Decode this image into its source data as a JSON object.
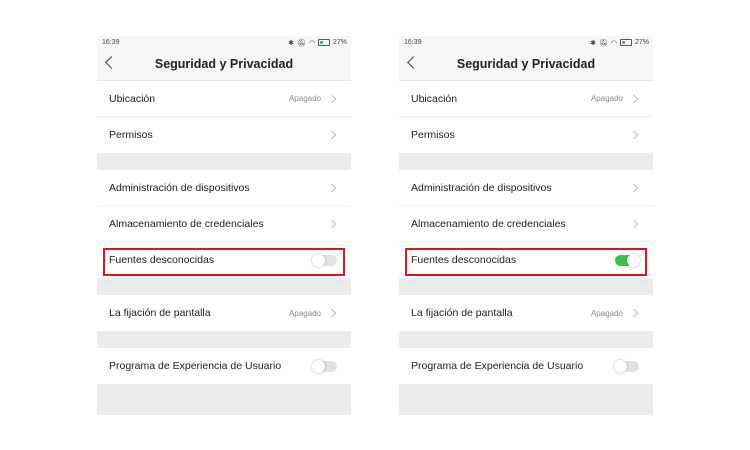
{
  "screens": [
    {
      "status": {
        "time": "16:39",
        "battery": "27%"
      },
      "title": "Seguridad y Privacidad",
      "rows": {
        "ubicacion": {
          "label": "Ubicación",
          "value": "Apagado"
        },
        "permisos": {
          "label": "Permisos"
        },
        "admin": {
          "label": "Administración de dispositivos"
        },
        "credenciales": {
          "label": "Almacenamiento de credenciales"
        },
        "fuentes": {
          "label": "Fuentes desconocidas",
          "toggle": "off"
        },
        "fijacion": {
          "label": "La fijación de pantalla",
          "value": "Apagado"
        },
        "experiencia": {
          "label": "Programa de Experiencia de Usuario",
          "toggle": "off"
        }
      }
    },
    {
      "status": {
        "time": "16:39",
        "battery": "27%"
      },
      "title": "Seguridad y Privacidad",
      "rows": {
        "ubicacion": {
          "label": "Ubicación",
          "value": "Apagado"
        },
        "permisos": {
          "label": "Permisos"
        },
        "admin": {
          "label": "Administración de dispositivos"
        },
        "credenciales": {
          "label": "Almacenamiento de credenciales"
        },
        "fuentes": {
          "label": "Fuentes desconocidas",
          "toggle": "on"
        },
        "fijacion": {
          "label": "La fijación de pantalla",
          "value": "Apagado"
        },
        "experiencia": {
          "label": "Programa de Experiencia de Usuario",
          "toggle": "off"
        }
      }
    }
  ],
  "colors": {
    "highlight": "#e0141e",
    "toggle_on": "#3cc24b",
    "toggle_off": "#e2e2e2"
  }
}
